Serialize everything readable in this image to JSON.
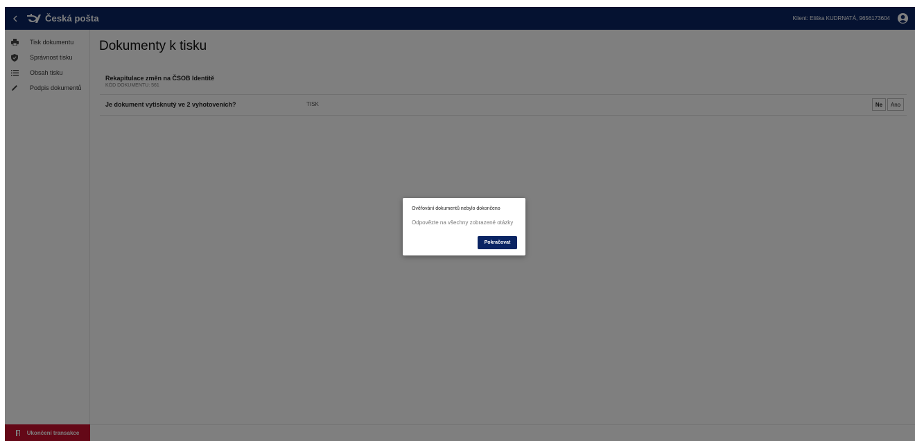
{
  "topbar": {
    "back_icon": "chevron-left-icon",
    "brand": "Česká pošta",
    "client_label": "Klient: Eliška KUDRNATÁ, 9656173604",
    "user_icon": "account-circle-icon"
  },
  "sidebar": {
    "items": [
      {
        "label": "Tisk dokumentu",
        "icon": "printer-icon"
      },
      {
        "label": "Správnost tisku",
        "icon": "shield-icon"
      },
      {
        "label": "Obsah tisku",
        "icon": "list-icon"
      },
      {
        "label": "Podpis dokumentů",
        "icon": "pen-icon"
      }
    ],
    "exit_label": "Ukončení transakce",
    "exit_icon": "door-exit-icon"
  },
  "main": {
    "title": "Dokumenty k tisku",
    "document": {
      "name": "Rekapitulace změn na ČSOB Identitě",
      "code": "KÓD DOKUMENTU: 561"
    },
    "question": {
      "text": "Je dokument vytisknutý ve 2 vyhotoveních?",
      "tag": "TISK",
      "no_label": "Ne",
      "yes_label": "Ano"
    }
  },
  "modal": {
    "title": "Ověřování dokumentů nebylo dokončeno",
    "message": "Odpovězte na všechny zobrazené otázky",
    "button_label": "Pokračovat"
  },
  "colors": {
    "primary": "#0a2463",
    "danger": "#c8102e",
    "overlay": "rgba(0,0,0,0.5)"
  }
}
